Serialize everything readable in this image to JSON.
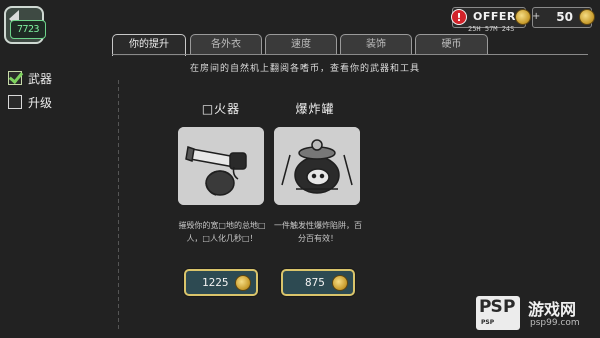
{
  "hud": {
    "level": "7723",
    "offer_label": "OFFER",
    "offer_alert": "!",
    "offer_timer": "25H 57M 24S",
    "coins": "50",
    "coin_plus": "+"
  },
  "tabs": [
    {
      "label": "你的提升"
    },
    {
      "label": "各外衣"
    },
    {
      "label": "速度"
    },
    {
      "label": "装饰"
    },
    {
      "label": "硬币"
    }
  ],
  "sidebar": {
    "items": [
      {
        "label": "武器",
        "checked": true
      },
      {
        "label": "升级",
        "checked": false
      }
    ]
  },
  "intro_text": "在房间的自然机上翻阅各嗜币，查看你的武器和工具",
  "items": [
    {
      "title": "□火器",
      "desc": "摧毁你的宽□地的总地□人，□人化几秒□！",
      "price": "1225"
    },
    {
      "title": "爆炸罐",
      "desc": "一件触发性爆炸陷阱，百分百有效！",
      "price": "875"
    }
  ],
  "watermark": {
    "logo_ps": "PS",
    "logo_p": "P",
    "logo_sub": "PSP",
    "title": "游戏网",
    "url": "psp99.com"
  }
}
